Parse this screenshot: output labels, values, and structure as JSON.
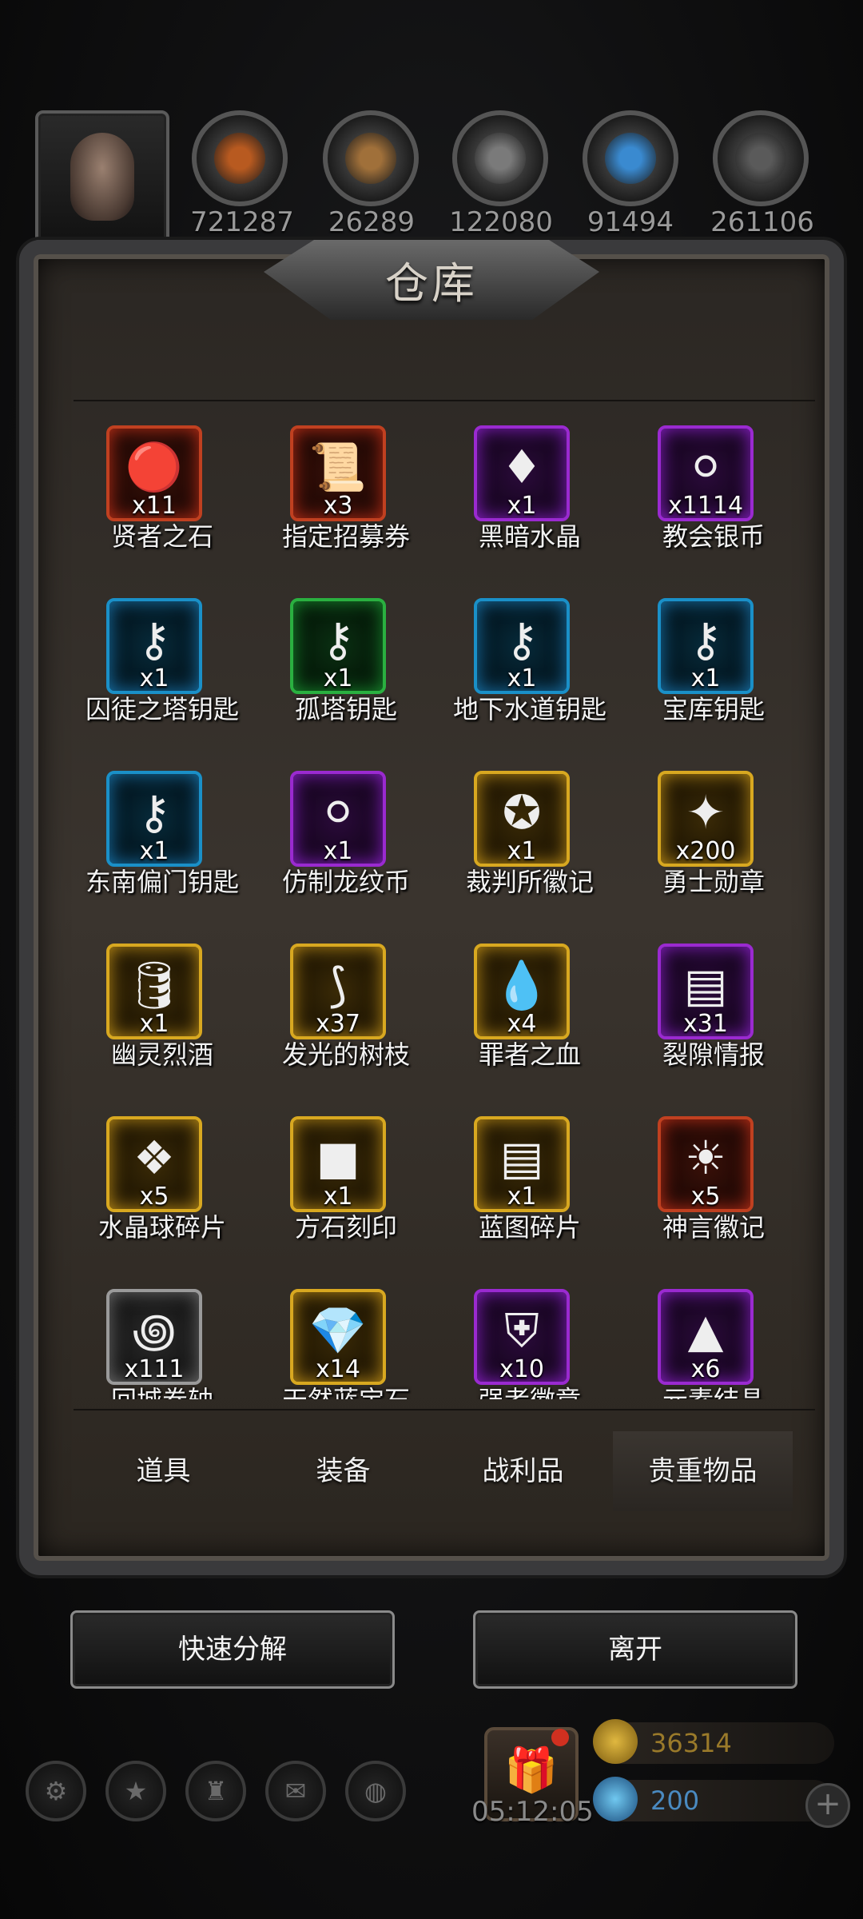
{
  "resources": [
    {
      "name": "food",
      "value": "721287",
      "color": "#b85a20"
    },
    {
      "name": "wood",
      "value": "26289",
      "color": "#a0703a"
    },
    {
      "name": "stone",
      "value": "122080",
      "color": "#7a7a7a"
    },
    {
      "name": "crystal",
      "value": "91494",
      "color": "#3a8ad0"
    },
    {
      "name": "iron",
      "value": "261106",
      "color": "#5a5a5a"
    }
  ],
  "panel": {
    "title": "仓库"
  },
  "items": [
    {
      "label": "贤者之石",
      "qty": "x11",
      "rarity": "red",
      "icon": "red-stone-icon"
    },
    {
      "label": "指定招募券",
      "qty": "x3",
      "rarity": "red",
      "icon": "scroll-icon"
    },
    {
      "label": "黑暗水晶",
      "qty": "x1",
      "rarity": "purple",
      "icon": "dark-crystal-icon"
    },
    {
      "label": "教会银币",
      "qty": "x1114",
      "rarity": "purple",
      "icon": "silver-coin-icon"
    },
    {
      "label": "囚徒之塔钥匙",
      "qty": "x1",
      "rarity": "blue",
      "icon": "key-icon"
    },
    {
      "label": "孤塔钥匙",
      "qty": "x1",
      "rarity": "green",
      "icon": "key-icon"
    },
    {
      "label": "地下水道钥匙",
      "qty": "x1",
      "rarity": "blue",
      "icon": "key-icon"
    },
    {
      "label": "宝库钥匙",
      "qty": "x1",
      "rarity": "blue",
      "icon": "key-icon"
    },
    {
      "label": "东南偏门钥匙",
      "qty": "x1",
      "rarity": "blue",
      "icon": "key-icon"
    },
    {
      "label": "仿制龙纹币",
      "qty": "x1",
      "rarity": "purple",
      "icon": "silver-coin-icon"
    },
    {
      "label": "裁判所徽记",
      "qty": "x1",
      "rarity": "gold",
      "icon": "emblem-icon"
    },
    {
      "label": "勇士勋章",
      "qty": "x200",
      "rarity": "gold",
      "icon": "medal-icon"
    },
    {
      "label": "幽灵烈酒",
      "qty": "x1",
      "rarity": "gold",
      "icon": "barrel-icon"
    },
    {
      "label": "发光的树枝",
      "qty": "x37",
      "rarity": "gold",
      "icon": "branch-icon"
    },
    {
      "label": "罪者之血",
      "qty": "x4",
      "rarity": "gold",
      "icon": "blood-drop-icon"
    },
    {
      "label": "裂隙情报",
      "qty": "x31",
      "rarity": "purple",
      "icon": "parchment-icon"
    },
    {
      "label": "水晶球碎片",
      "qty": "x5",
      "rarity": "gold",
      "icon": "crystal-shard-icon"
    },
    {
      "label": "方石刻印",
      "qty": "x1",
      "rarity": "gold",
      "icon": "stone-cube-icon"
    },
    {
      "label": "蓝图碎片",
      "qty": "x1",
      "rarity": "gold",
      "icon": "parchment-icon"
    },
    {
      "label": "神言徽记",
      "qty": "x5",
      "rarity": "red",
      "icon": "sun-emblem-icon"
    },
    {
      "label": "回城卷轴",
      "qty": "x111",
      "rarity": "gray",
      "icon": "swirl-icon"
    },
    {
      "label": "天然蓝宝石",
      "qty": "x14",
      "rarity": "gold",
      "icon": "sapphire-icon"
    },
    {
      "label": "强者徽章",
      "qty": "x10",
      "rarity": "purple",
      "icon": "badge-icon"
    },
    {
      "label": "元素结晶",
      "qty": "x6",
      "rarity": "purple",
      "icon": "pyramid-icon"
    }
  ],
  "tabs": [
    {
      "label": "道具",
      "active": false
    },
    {
      "label": "装备",
      "active": false
    },
    {
      "label": "战利品",
      "active": false
    },
    {
      "label": "贵重物品",
      "active": true
    }
  ],
  "buttons": {
    "quick_decompose": "快速分解",
    "leave": "离开"
  },
  "hud": {
    "timer": "05:12:05",
    "gold": "36314",
    "gems": "200",
    "bottom_icons": [
      "settings-icon",
      "star-icon",
      "castle-icon",
      "mail-icon",
      "globe-icon"
    ]
  }
}
